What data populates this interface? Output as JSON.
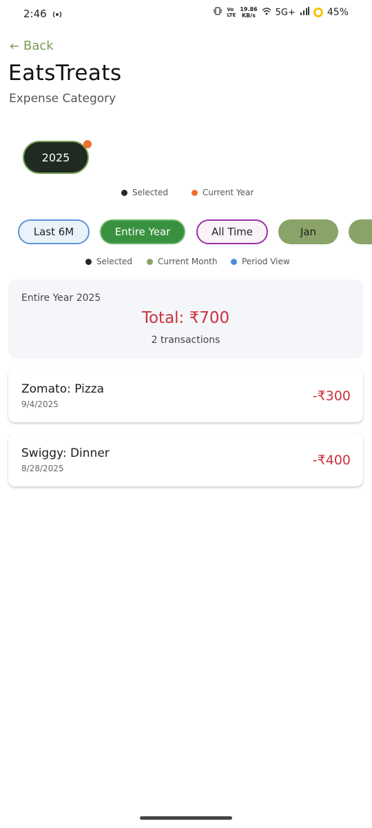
{
  "status_bar": {
    "time": "2:46",
    "network_speed_value": "19.86",
    "network_speed_unit": "KB/s",
    "network_type": "5G+",
    "battery": "45%"
  },
  "header": {
    "back_label": "Back",
    "title": "EatsTreats",
    "subtitle": "Expense Category"
  },
  "year_selector": {
    "selected_year": "2025",
    "legend": [
      {
        "label": "Selected",
        "color": "#1f2a21"
      },
      {
        "label": "Current Year",
        "color": "#f0712e"
      }
    ]
  },
  "period_filter": {
    "chips": [
      {
        "label": "Last 6M"
      },
      {
        "label": "Entire Year",
        "selected": true
      },
      {
        "label": "All Time"
      },
      {
        "label": "Jan"
      }
    ],
    "legend": [
      {
        "label": "Selected",
        "color": "#1f2a21"
      },
      {
        "label": "Current Month",
        "color": "#8aa368"
      },
      {
        "label": "Period View",
        "color": "#4a90d9"
      }
    ]
  },
  "summary": {
    "period_label": "Entire Year 2025",
    "total": "Total: ₹700",
    "count": "2 transactions"
  },
  "transactions": [
    {
      "name": "Zomato: Pizza",
      "date": "9/4/2025",
      "amount": "-₹300"
    },
    {
      "name": "Swiggy: Dinner",
      "date": "8/28/2025",
      "amount": "-₹400"
    }
  ],
  "colors": {
    "accent_green": "#38913f",
    "negative_red": "#c8323c",
    "back_link": "#7a9a57"
  }
}
